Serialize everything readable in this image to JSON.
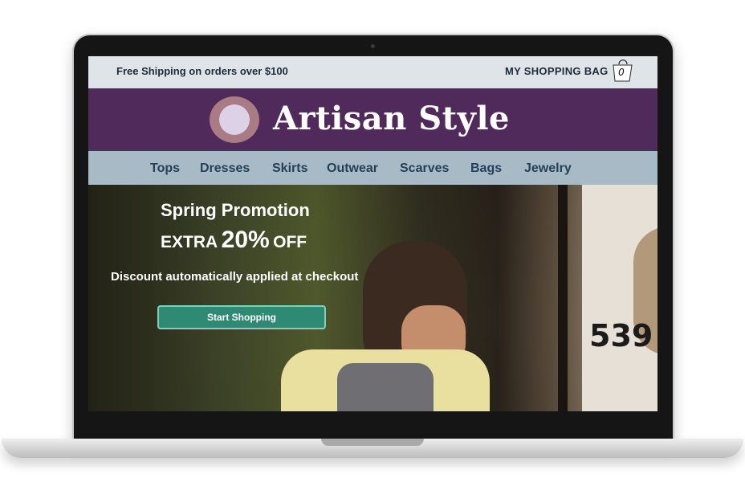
{
  "topbar": {
    "shipping_text": "Free Shipping on orders over $100",
    "bag_label": "MY SHOPPING BAG",
    "bag_count": "0"
  },
  "brand": {
    "name": "Artisan Style"
  },
  "nav": {
    "items": [
      {
        "label": "Tops"
      },
      {
        "label": "Dresses"
      },
      {
        "label": "Skirts"
      },
      {
        "label": "Outwear"
      },
      {
        "label": "Scarves"
      },
      {
        "label": "Bags"
      },
      {
        "label": "Jewelry"
      }
    ]
  },
  "hero": {
    "title": "Spring Promotion",
    "extra_label": "EXTRA",
    "percent_label": "20%",
    "off_label": "OFF",
    "description": "Discount automatically applied at checkout",
    "cta_label": "Start Shopping",
    "house_number": "539"
  },
  "colors": {
    "topbar": "#dfe4e8",
    "brandbar": "#4f2a5a",
    "navbar": "#a7bac6",
    "nav_text": "#25415a",
    "cta": "#2f8a73"
  },
  "icons": {
    "bag": "shopping-bag-icon",
    "logo": "brand-logo-icon"
  }
}
